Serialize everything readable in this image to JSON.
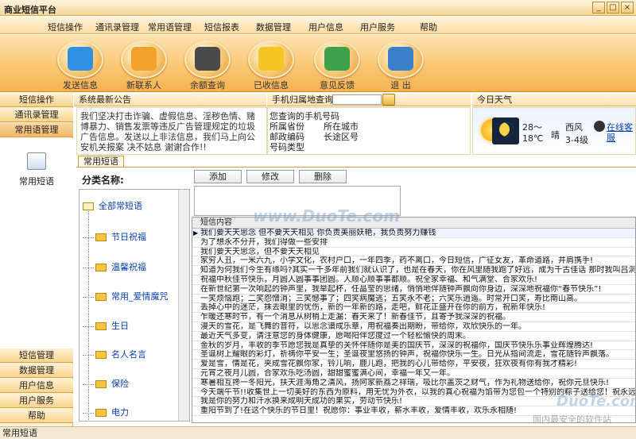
{
  "app": {
    "title": "商业短信平台",
    "win_btns": [
      "_",
      "□",
      "×"
    ]
  },
  "menu": [
    "短信操作",
    "通讯录管理",
    "常用语管理",
    "短信报表",
    "数据管理",
    "用户信息",
    "用户服务",
    "帮助"
  ],
  "toolbar": [
    {
      "label": "发送信息",
      "icon": "send-icon",
      "color": "#2f8fe0"
    },
    {
      "label": "新联系人",
      "icon": "new-contact-icon",
      "color": "#f2a12a"
    },
    {
      "label": "余额查询",
      "icon": "balance-query-icon",
      "color": "#4a4a4a"
    },
    {
      "label": "已收信息",
      "icon": "inbox-icon",
      "color": "#f3c623"
    },
    {
      "label": "意见反馈",
      "icon": "feedback-icon",
      "color": "#3fa24a"
    },
    {
      "label": "退  出",
      "icon": "exit-icon",
      "color": "#3a7fc9"
    }
  ],
  "nav": {
    "top": [
      "短信操作",
      "通讯录管理",
      "常用语管理"
    ],
    "selected_label": "常用短语",
    "bottom": [
      "短信管理",
      "数据管理",
      "用户信息",
      "用户服务",
      "帮助"
    ]
  },
  "notice": {
    "title": "系统最新公告",
    "text": "我们坚决打击诈骗、虚假信息、淫秽色情、赌博暴力、销售发票等违反广告管理规定的垃圾广告信息。发送以上非法信息，我们马上向公安机关报案  决不姑息 谢谢合作!!"
  },
  "phone": {
    "title": "手机归属地查询",
    "query_label": "您查询的手机号码",
    "fields": [
      {
        "k": "所属省份",
        "v": "所在城市"
      },
      {
        "k": "邮政编码",
        "v": "长途区号"
      },
      {
        "k": "号码类型",
        "v": ""
      }
    ]
  },
  "weather": {
    "title": "今日天气",
    "temp_high": "28～",
    "temp_low": "18℃",
    "condition": "晴",
    "wind": "西风",
    "wind_level": "3-4级",
    "service": "在线客服"
  },
  "content": {
    "tab": "常用短语",
    "cat_title": "分类名称:",
    "add": "添加",
    "edit": "修改",
    "delete": "删除",
    "grid_header": "短信内容",
    "categories": [
      "全部常短语",
      "节日祝福",
      "温馨祝福",
      "常用_爱情魔咒",
      "生日",
      "名人名言",
      "保险",
      "电力"
    ],
    "rows": [
      "我们要天天思念  但不要天天相见  你负责美丽妖艳，我负责努力赚钱",
      "为了想永不分开，我们得做一些安排",
      "我们要天天思念，但不要天天相见",
      "家穷人丑，一米六九，小学文化，农村户口，一年四季，药不离口，今日短信，广征女友，革命道路，并肩携手!",
      "知道为何我们今生有缘吗?其实一千多年前我们就认识了，也是在春天，你在风里随我跑了好远，成为千古佳话 那时我叫吕洞宾",
      "祝福中秋佳节快乐，月圆人圆事事团圆。人顺心顺事事都顺。祝全家幸福、和气满堂、合家欢乐!",
      "在新世纪第一次响起的钟声里，我举起杯，任晶莹的思绪，悄悄地伴随钟声飘向你身边，深深地祝福你“春节快乐”!",
      "一笑烦恼跑；二笑怨憎消；三笑憾事了；四笑病魔逃；五笑永不老；六笑乐逍遥。时常开口笑，寿比南山高。",
      "丢掉心中的迷茫，抹去眼里的忧伤，新的一年新的路，走吧，鲜花正盛开在你的前方，祝新年快乐!",
      "乍暖还寒时节，有一个消息从树梢上走漏：春天来了！新春佳节，且寄予我深深的祝福。",
      "漫天的雪花，是飞舞的音符，以思念谱成乐章，用祝福奏出期盼，带给你，欢欣快乐的一年。",
      "最近天气多变，请注意您的身体健康，愿喝阳伴您度过一个轻松愉快的周末。",
      "金秋的岁月，丰收的季节愿您我是真挚的关怀伴随你是美的国庆节，深深的祝福你，国庆节快乐乐事业辉煌腾达!",
      "圣诞树上耀眼的彩灯，祈祷你平安一生；圣诞夜里悠扬的钟声，祝福你快乐一生。日光从指间流走，雪花随铃声飘落。",
      "爱是雪，情是花，夹成雪花飘你家，铃儿响，鹿儿跑，把我的心儿带给你，平安夜，狂欢夜有你有我才精彩!",
      "元宵之夜月儿圆，合家欢乐吃汤圆，甜甜蜜蜜满心间，幸福一年又一年。",
      "寒暑相互搀一冬阳光，扶天涯海角之清风，扬阿家新荔之祥瑞，吸比尔盖茨之财气，作为礼物送给你，祝你元旦快乐!",
      "今天端午节!!收集世上一切美好的东西为原料，用无忧为外衣，以我的真心祝福为馅带为您包一个特别的粽子送给您！祝永远快乐",
      "我是你的努力和汗水换来成明天成功的果实，劳动节快乐!",
      "重阳节到了!在这个快乐的节日里！祝愿你：事业丰收，薪水丰收，爱情丰收，欢乐永相随!"
    ]
  },
  "status": {
    "text": "常用短语"
  },
  "watermark": {
    "site": "www.DuoTe.com",
    "logo": "DuoTe.com",
    "slogan": "国内最安全的软件站"
  }
}
